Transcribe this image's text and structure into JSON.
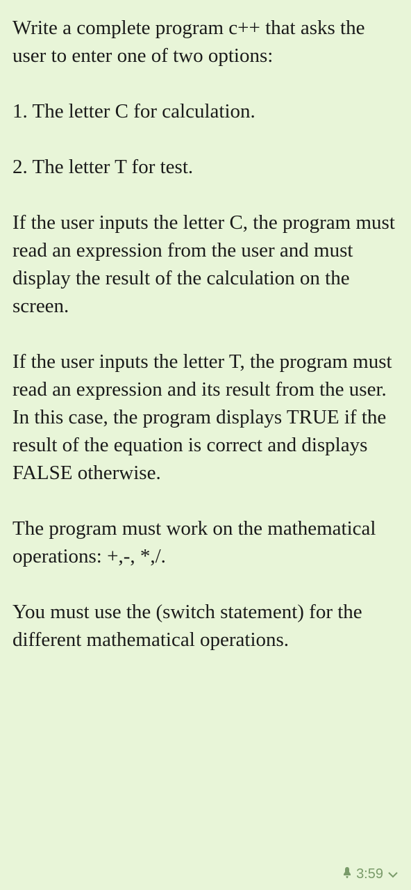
{
  "paragraphs": {
    "intro": "Write a complete program c++ that asks the user to enter one of two options:",
    "option1": "1. The letter C for calculation.",
    "option2": "2. The letter T for test.",
    "ifC": "If the user inputs the letter C, the program must read an expression from the user and must display the result of the calculation on the screen.",
    "ifT": "If the user inputs the letter T, the program must read an expression and its result from the user. In this case, the program displays TRUE if the result of the equation is correct and displays FALSE otherwise.",
    "operations": "The program must work on the mathematical operations: +,-, *,/.",
    "switch": "You must use the (switch statement) for the different mathematical operations."
  },
  "timestamp": "3:59"
}
